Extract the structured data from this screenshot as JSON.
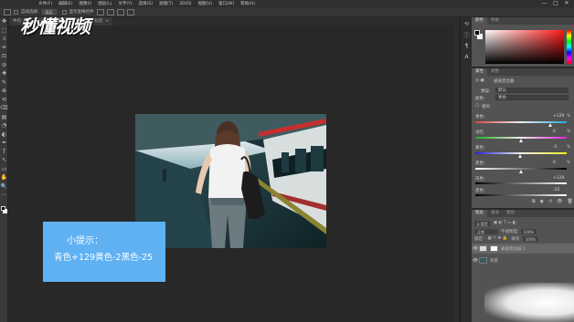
{
  "menu": {
    "items": [
      "文件(F)",
      "编辑(E)",
      "图像(I)",
      "图层(L)",
      "文字(Y)",
      "选择(S)",
      "滤镜(T)",
      "3D(D)",
      "视图(V)",
      "窗口(W)",
      "帮助(H)"
    ]
  },
  "window_controls": [
    "—",
    "□",
    "✕"
  ],
  "options_bar": {
    "auto_select_label": "自动选择:",
    "auto_select_value": "图层",
    "show_transform_label": "显示变换控件"
  },
  "tabs": [
    {
      "label": "中的 ...",
      "close": "×"
    },
    {
      "label": "...psd @ 66.7%",
      "close": "×"
    },
    {
      "label": "更多标签",
      "close": "×"
    }
  ],
  "logo": {
    "text": "秒懂视频"
  },
  "toolbar": {
    "icons": [
      "move-tool-icon",
      "marquee-tool-icon",
      "lasso-tool-icon",
      "quick-select-icon",
      "crop-tool-icon",
      "eyedropper-icon",
      "healing-brush-icon",
      "brush-tool-icon",
      "clone-stamp-icon",
      "history-brush-icon",
      "eraser-icon",
      "gradient-icon",
      "blur-icon",
      "dodge-icon",
      "pen-tool-icon",
      "type-tool-icon",
      "path-select-icon",
      "shape-tool-icon",
      "hand-tool-icon",
      "zoom-tool-icon",
      "more-tools-icon"
    ],
    "glyphs": [
      "✥",
      "⬚",
      "ↄ",
      "⌯",
      "⊡",
      "⊘",
      "✚",
      "✎",
      "⊕",
      "⟲",
      "⌫",
      "▤",
      "◔",
      "◐",
      "✒",
      "T",
      "↖",
      "▭",
      "✋",
      "🔍",
      "⋯"
    ]
  },
  "tip": {
    "title": "小提示：",
    "body": "青色+129黄色-2黑色-25"
  },
  "color_panel": {
    "tabs": [
      "颜色",
      "色板"
    ]
  },
  "properties_panel": {
    "tabs": [
      "属性",
      "调整"
    ],
    "title": "通道混合器",
    "preset_label": "预设:",
    "preset_value": "默认",
    "color_label": "颜色:",
    "color_value": "青色",
    "method_label": "相对",
    "sliders": [
      {
        "label": "青色:",
        "value": "+129",
        "pos": 0.82,
        "gradient": "linear-gradient(to right, #d44, #eee, #2ad)"
      },
      {
        "label": "洋红:",
        "value": "0",
        "pos": 0.5,
        "gradient": "linear-gradient(to right, #2a2, #eee, #d2d)"
      },
      {
        "label": "黄色:",
        "value": "-2",
        "pos": 0.49,
        "gradient": "linear-gradient(to right, #22d, #eee, #ee2)"
      },
      {
        "label": "黑色:",
        "value": "0",
        "pos": 0.5,
        "gradient": "linear-gradient(to right, #fff, #000)"
      }
    ],
    "white_label": "白色:",
    "white_value": "+129",
    "black_label": "黑色:",
    "black_value": "-25",
    "pct": "%"
  },
  "layers_panel": {
    "tabs": [
      "图层",
      "通道",
      "路径"
    ],
    "blend_mode": "正常",
    "opacity_label": "不透明度:",
    "opacity_value": "100%",
    "lock_label": "锁定:",
    "fill_label": "填充:",
    "fill_value": "100%",
    "layers": [
      {
        "name": "通道混合器 1",
        "selected": true
      },
      {
        "name": "背景",
        "selected": false
      }
    ]
  },
  "colors": {
    "tip_bg": "#5fb1f2",
    "panel_bg": "#535353",
    "canvas_bg": "#282828"
  }
}
